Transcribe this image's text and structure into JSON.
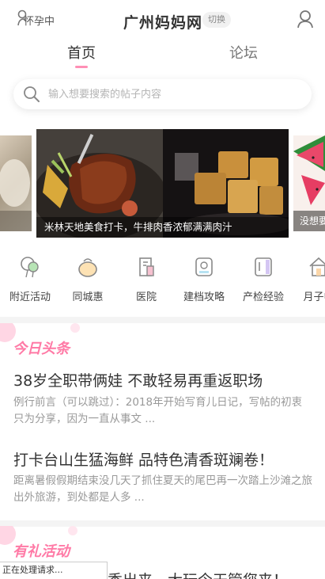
{
  "header": {
    "status_label": "怀孕中",
    "city_title": "广州妈妈网",
    "switch_label": "切换"
  },
  "tabs": {
    "home": "首页",
    "forum": "论坛"
  },
  "search": {
    "placeholder": "输入想要搜索的帖子内容"
  },
  "carousel": {
    "main_caption": "米林天地美食打卡，牛排肉香浓郁满满肉汁",
    "next_caption": "没想要"
  },
  "categories": [
    {
      "label": "附近活动",
      "icon": "balloon-icon"
    },
    {
      "label": "同城惠",
      "icon": "money-bag-icon"
    },
    {
      "label": "医院",
      "icon": "hospital-icon"
    },
    {
      "label": "建档攻略",
      "icon": "id-card-icon"
    },
    {
      "label": "产检经验",
      "icon": "book-icon"
    },
    {
      "label": "月子中",
      "icon": "house-icon"
    }
  ],
  "sections": {
    "headlines_title": "今日头条",
    "events_title": "有礼活动"
  },
  "news": [
    {
      "title": "38岁全职带俩娃 不敢轻易再重返职场",
      "desc": "例行前言（可以跳过）：2018年开始写育儿日记，写帖的初衷只为分享，因为一直从事文 ..."
    },
    {
      "title": "打卡台山生猛海鲜 品特色清香斑斓卷！",
      "desc": "距离暑假假期结束没几天了抓住夏天的尾巴再一次踏上沙滩之旅出外旅游，到处都是人多 ..."
    }
  ],
  "partial_post_title": "秀出来，大玩今天管您来！",
  "toast": "正在处理请求...",
  "colors": {
    "accent_pink": "#ff8fb5",
    "section_pink": "#ff7aa6"
  }
}
